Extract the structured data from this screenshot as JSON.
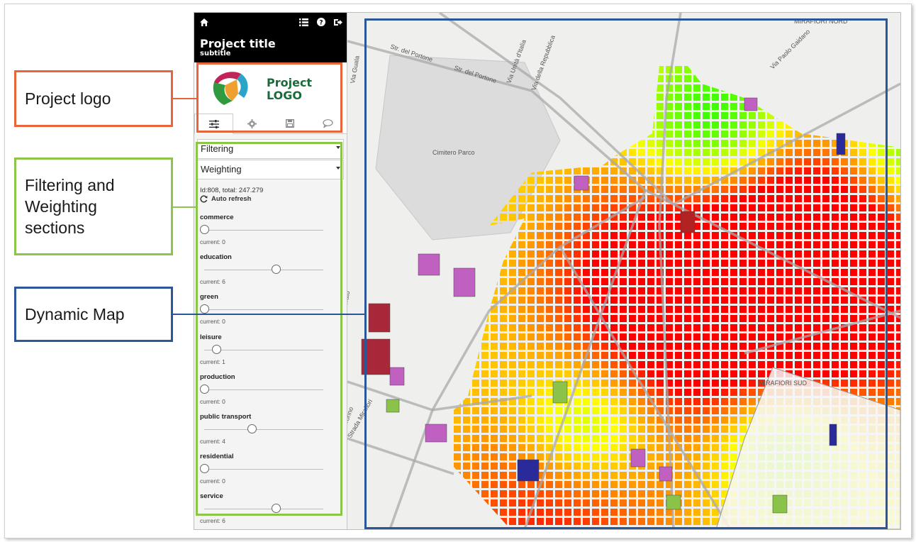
{
  "callouts": {
    "logo": "Project logo",
    "filtering": "Filtering and\nWeighting\nsections",
    "map": "Dynamic Map"
  },
  "colors": {
    "logo_callout": "#e8643a",
    "filter_callout": "#8dc44a",
    "map_callout": "#2b5797"
  },
  "app": {
    "topbar": {
      "title": "Project title",
      "subtitle": "subtitle",
      "icons": [
        "home-icon",
        "list-icon",
        "help-icon",
        "logout-icon"
      ]
    },
    "logo": {
      "text": "Project\nLOGO"
    },
    "tabs": [
      "sliders-icon",
      "gear-icon",
      "save-icon",
      "comment-icon"
    ],
    "sections": {
      "filtering": "Filtering",
      "weighting": "Weighting"
    },
    "stats": "Id:808, total: 247.279",
    "auto_refresh": "Auto refresh",
    "criteria": [
      {
        "label": "commerce",
        "current_text": "current: 0",
        "value": 0
      },
      {
        "label": "education",
        "current_text": "current: 6",
        "value": 6
      },
      {
        "label": "green",
        "current_text": "current: 0",
        "value": 0
      },
      {
        "label": "leisure",
        "current_text": "current: 1",
        "value": 1
      },
      {
        "label": "production",
        "current_text": "current: 0",
        "value": 0
      },
      {
        "label": "public transport",
        "current_text": "current: 4",
        "value": 4
      },
      {
        "label": "residential",
        "current_text": "current: 0",
        "value": 0
      },
      {
        "label": "service",
        "current_text": "current: 6",
        "value": 6
      }
    ],
    "slider_max": 10
  },
  "map": {
    "labels": [
      "Str. del Portone",
      "Str. del Portone",
      "Via Guala",
      "Via Unità d'Italia",
      "Via della Repubblica",
      "Via Paolo Gaidano",
      "Cimitero Parco",
      "MIRAFIORI NORD",
      "MIRAFIORI SUD",
      "Via Onorato",
      "Torino",
      "Strada Mirafiori"
    ]
  }
}
